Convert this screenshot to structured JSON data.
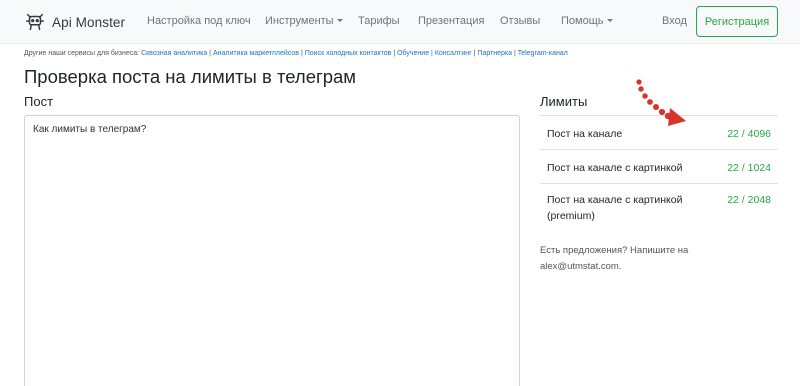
{
  "brand": {
    "name": "Api Monster",
    "logo_icon": "robot-icon"
  },
  "nav": {
    "items": [
      {
        "label": "Настройка под ключ",
        "dropdown": false
      },
      {
        "label": "Инструменты",
        "dropdown": true
      },
      {
        "label": "Тарифы",
        "dropdown": false
      },
      {
        "label": "Презентация",
        "dropdown": false
      },
      {
        "label": "Отзывы",
        "dropdown": false
      },
      {
        "label": "Помощь",
        "dropdown": true
      }
    ],
    "login": "Вход",
    "register": "Регистрация"
  },
  "services": {
    "prefix": "Другие наши сервисы для бизнеса:",
    "links": [
      "Сквозная аналитика",
      "Аналитика маркетплейсов",
      "Поиск холодных контактов",
      "Обучение",
      "Консалтинг",
      "Партнерка",
      "Telegram-канал"
    ]
  },
  "page": {
    "title": "Проверка поста на лимиты в телеграм"
  },
  "post": {
    "label": "Пост",
    "value": "Как лимиты в телеграм?"
  },
  "limits": {
    "label": "Лимиты",
    "rows": [
      {
        "name": "Пост на канале",
        "value": "22 / 4096"
      },
      {
        "name": "Пост на канале с картинкой",
        "value": "22 / 1024"
      },
      {
        "name": "Пост на канале с картинкой (premium)",
        "value": "22 / 2048"
      }
    ],
    "proposal": "Есть предложения? Напишите на alex@utmstat.com."
  },
  "colors": {
    "accent": "#28a745",
    "link": "#1a73c8",
    "arrow": "#d9342b",
    "navbar_bg": "#f8f9fa"
  }
}
